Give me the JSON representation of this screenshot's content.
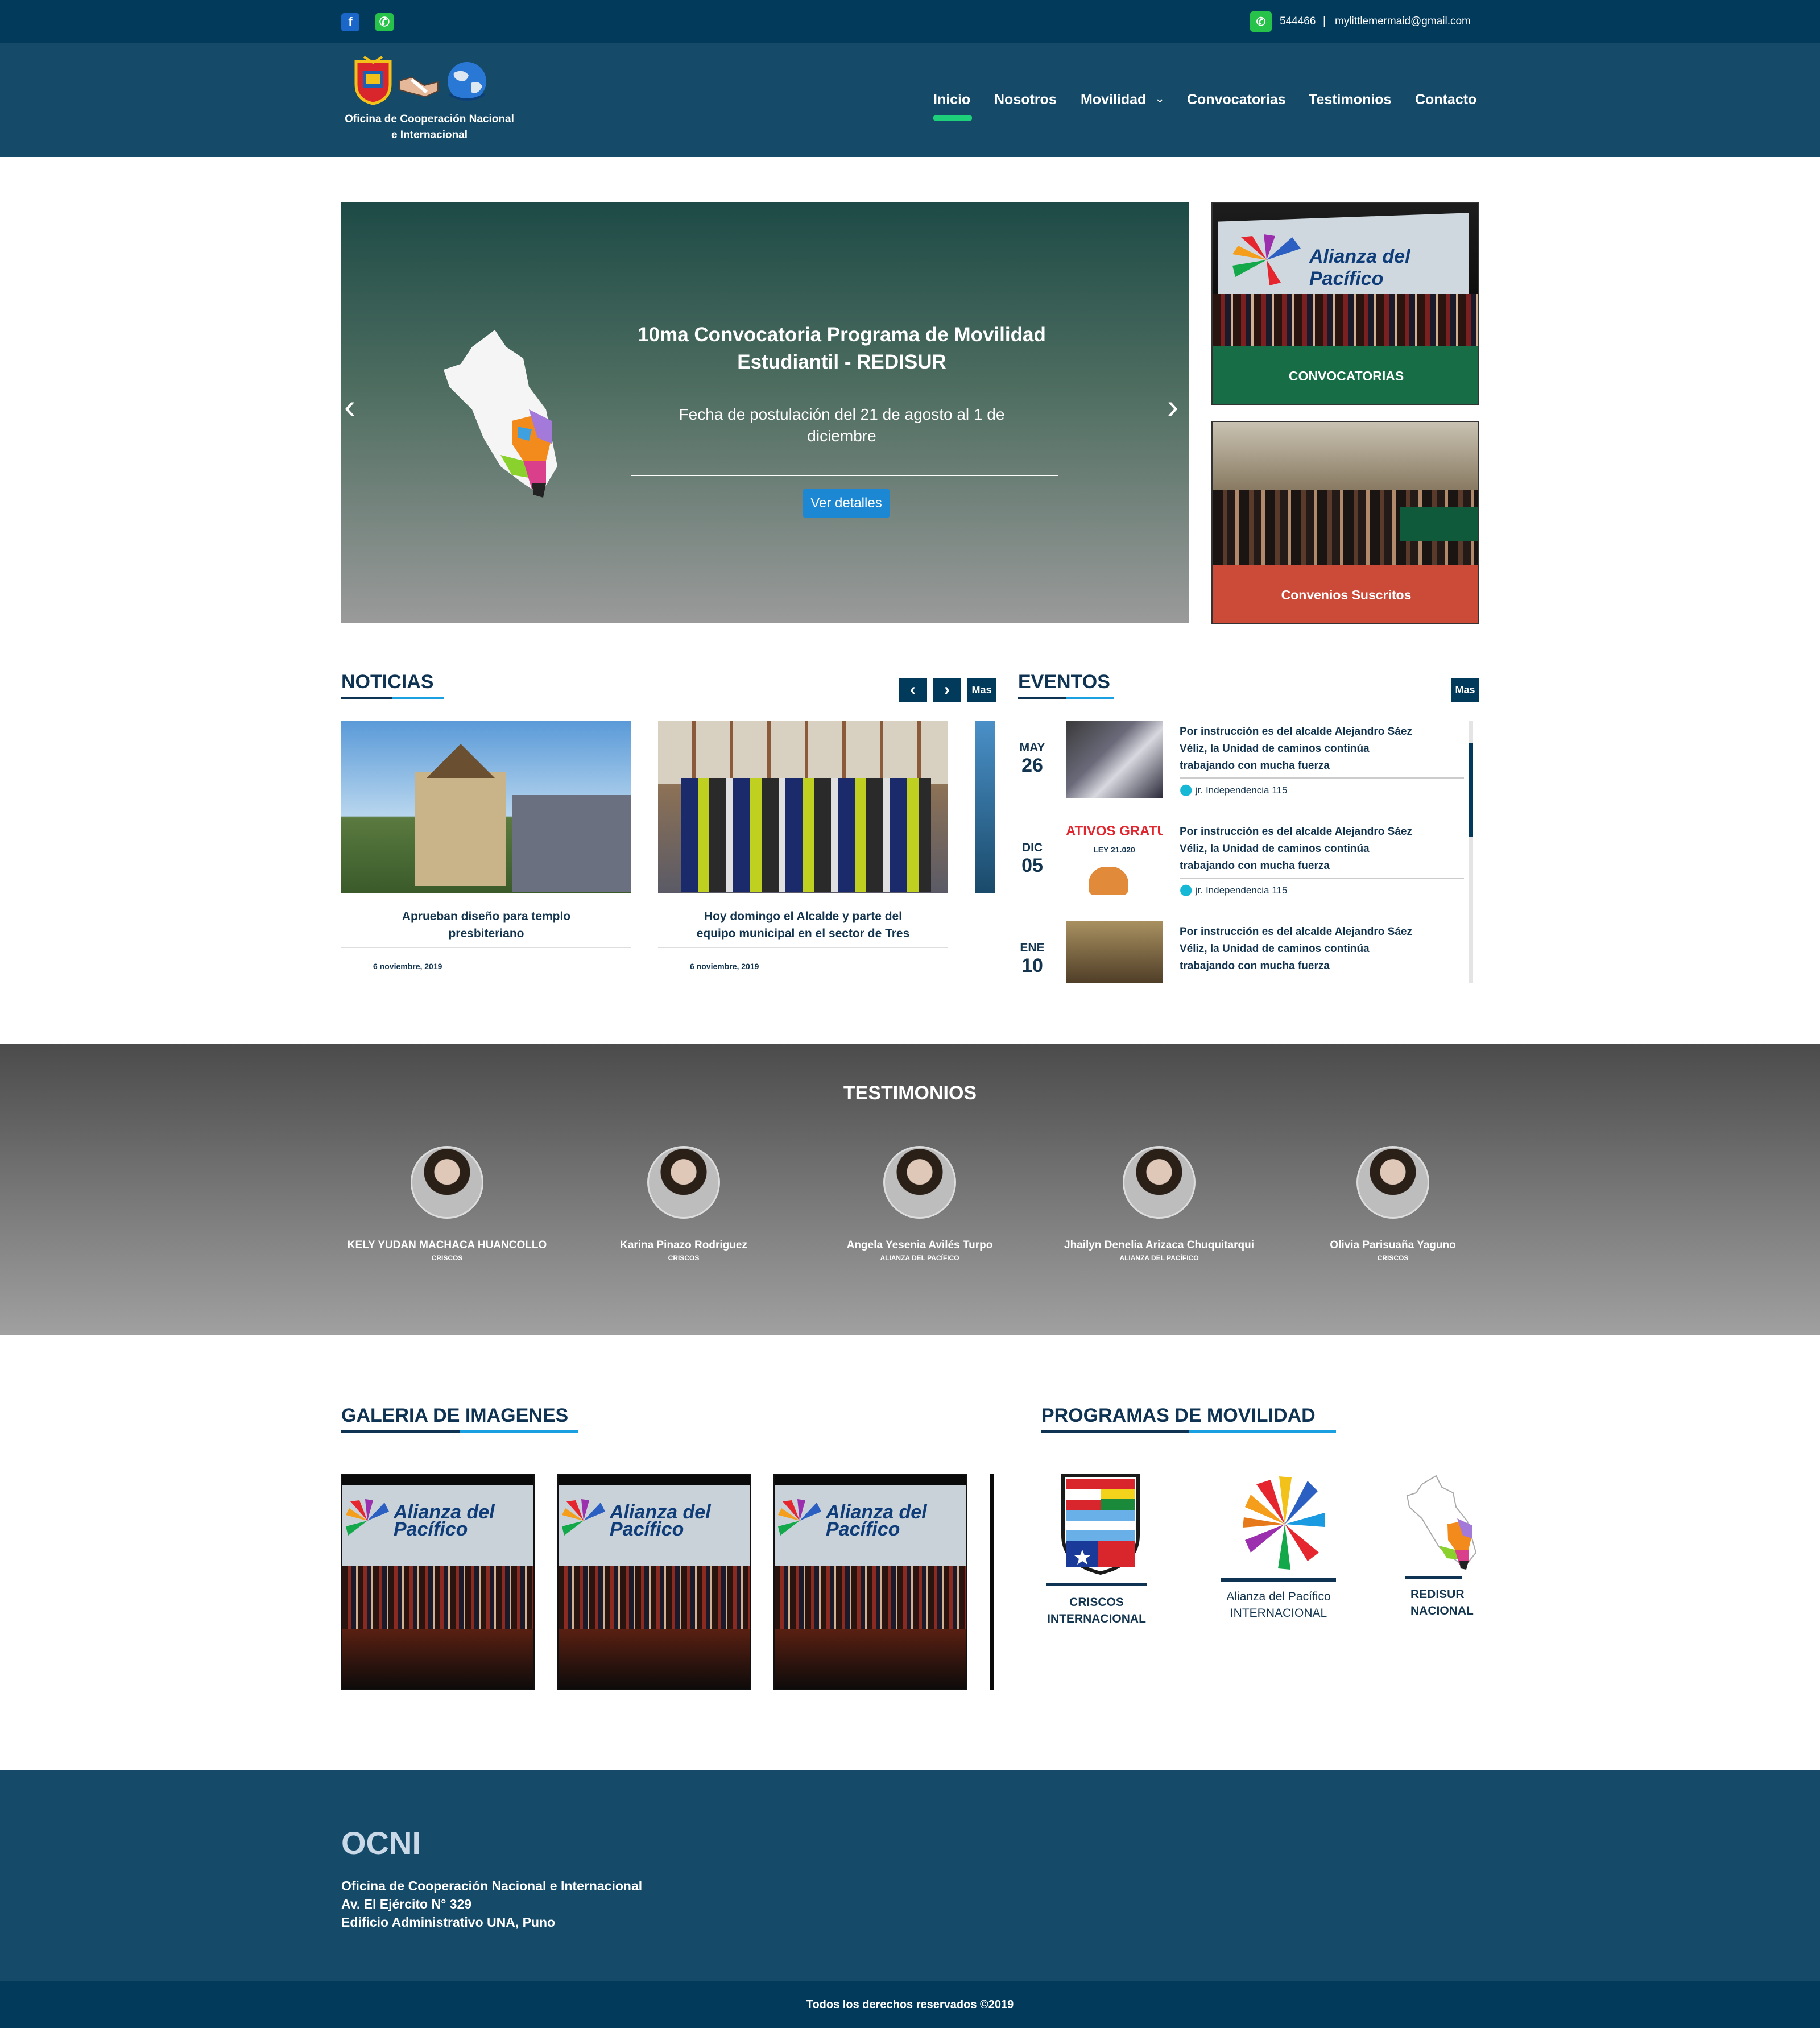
{
  "topbar": {
    "phone": "544466",
    "separator": "|",
    "email": "mylittlemermaid@gmail.com"
  },
  "logo": {
    "line1": "Oficina de Cooperación Nacional",
    "line2": "e Internacional"
  },
  "nav": {
    "items": [
      "Inicio",
      "Nosotros",
      "Movilidad",
      "Convocatorias",
      "Testimonios",
      "Contacto"
    ],
    "active": "Inicio"
  },
  "slider": {
    "title_line1": "10ma Convocatoria Programa de Movilidad",
    "title_line2": "Estudiantil - REDISUR",
    "desc_line1": "Fecha de postulación del 21 de agosto al 1 de",
    "desc_line2": "diciembre",
    "button": "Ver detalles"
  },
  "side_cards": [
    {
      "label": "CONVOCATORIAS",
      "banner": "Alianza del Pacífico",
      "color": "#176d45"
    },
    {
      "label": "Convenios Suscritos",
      "color": "#cc4a38"
    }
  ],
  "noticias": {
    "title": "NOTICIAS",
    "more": "Mas",
    "items": [
      {
        "title_line1": "Aprueban diseño para templo",
        "title_line2": "presbiteriano",
        "date": "6 noviembre, 2019"
      },
      {
        "title_line1": "Hoy domingo el Alcalde y parte del",
        "title_line2": "equipo municipal en el sector de Tres",
        "date": "6 noviembre, 2019"
      }
    ]
  },
  "eventos": {
    "title": "EVENTOS",
    "more": "Mas",
    "items": [
      {
        "month": "MAY",
        "day": "26",
        "line1": "Por instrucción es del alcalde Alejandro Sáez",
        "line2": "Véliz, la Unidad de caminos continúa",
        "line3": "trabajando con mucha fuerza",
        "location": "jr. Independencia 115"
      },
      {
        "month": "DIC",
        "day": "05",
        "line1": "Por instrucción es del alcalde Alejandro Sáez",
        "line2": "Véliz, la Unidad de caminos continúa",
        "line3": "trabajando con mucha fuerza",
        "location": "jr. Independencia 115",
        "thumb_text": "ATIVOS GRATUI",
        "thumb_sub": "LEY 21.020"
      },
      {
        "month": "ENE",
        "day": "10",
        "line1": "Por instrucción es del alcalde Alejandro Sáez",
        "line2": "Véliz, la Unidad de caminos continúa",
        "line3": "trabajando con mucha fuerza"
      }
    ]
  },
  "testimonios": {
    "title": "TESTIMONIOS",
    "items": [
      {
        "name": "KELY YUDAN MACHACA HUANCOLLO",
        "program": "CRISCOS"
      },
      {
        "name": "Karina Pinazo Rodriguez",
        "program": "CRISCOS"
      },
      {
        "name": "Angela Yesenia Avilés Turpo",
        "program": "ALIANZA DEL PACÍFICO"
      },
      {
        "name": "Jhailyn Denelia Arizaca Chuquitarqui",
        "program": "ALIANZA DEL PACÍFICO"
      },
      {
        "name": "Olivia Parisuaña Yaguno",
        "program": "CRISCOS"
      }
    ]
  },
  "galeria": {
    "title": "GALERIA DE IMAGENES",
    "banner_line1": "Alianza del",
    "banner_line2": "Pacífico"
  },
  "programas": {
    "title": "PROGRAMAS DE MOVILIDAD",
    "items": [
      {
        "line1": "CRISCOS",
        "line2": "INTERNACIONAL"
      },
      {
        "line1": "Alianza del Pacífico",
        "line2": "INTERNACIONAL"
      },
      {
        "line1": "REDISUR",
        "line2": "NACIONAL"
      }
    ]
  },
  "footer": {
    "brand": "OCNI",
    "line1": "Oficina de Cooperación Nacional e Internacional",
    "line2": "Av. El Ejército N° 329",
    "line3": "Edificio Administrativo UNA, Puno",
    "copyright": "Todos los derechos reservados ©2019"
  },
  "colors": {
    "topbar": "#023a5b",
    "header": "#154a69",
    "accent": "#1ed07a",
    "link_blue": "#1aa0e0",
    "convocatorias": "#176d45",
    "convenios": "#cc4a38"
  }
}
